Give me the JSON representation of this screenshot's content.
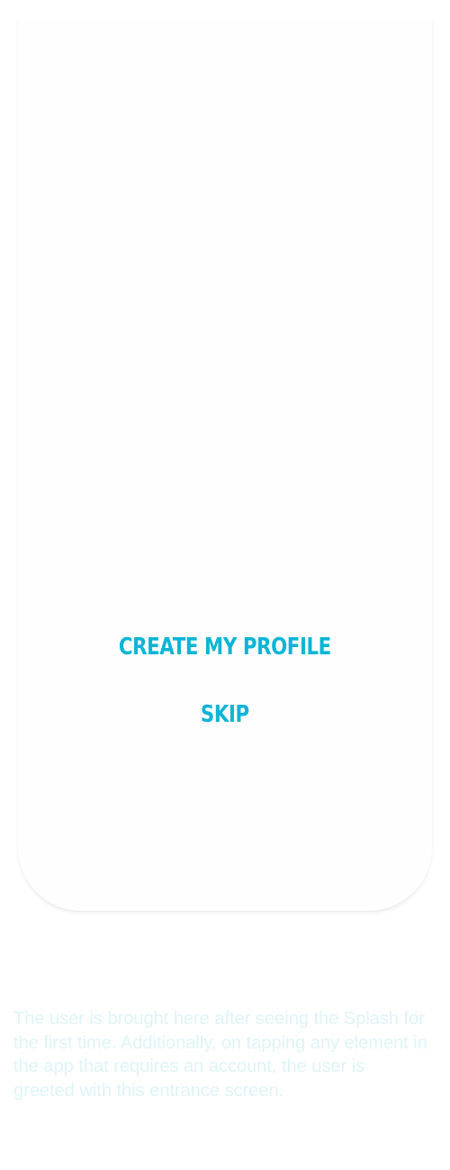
{
  "entrance": {
    "create_profile_label": "CREATE MY PROFILE",
    "skip_label": "SKIP"
  },
  "annotation": {
    "text": "The user is brought here after seeing the Splash for the first time. Additionally, on tapping any element in the app that requires an account, the user is greeted with this entrance screen."
  },
  "colors": {
    "accent": "#0bb5d6",
    "caption": "#dff4f8",
    "card_background": "#fefefe"
  }
}
